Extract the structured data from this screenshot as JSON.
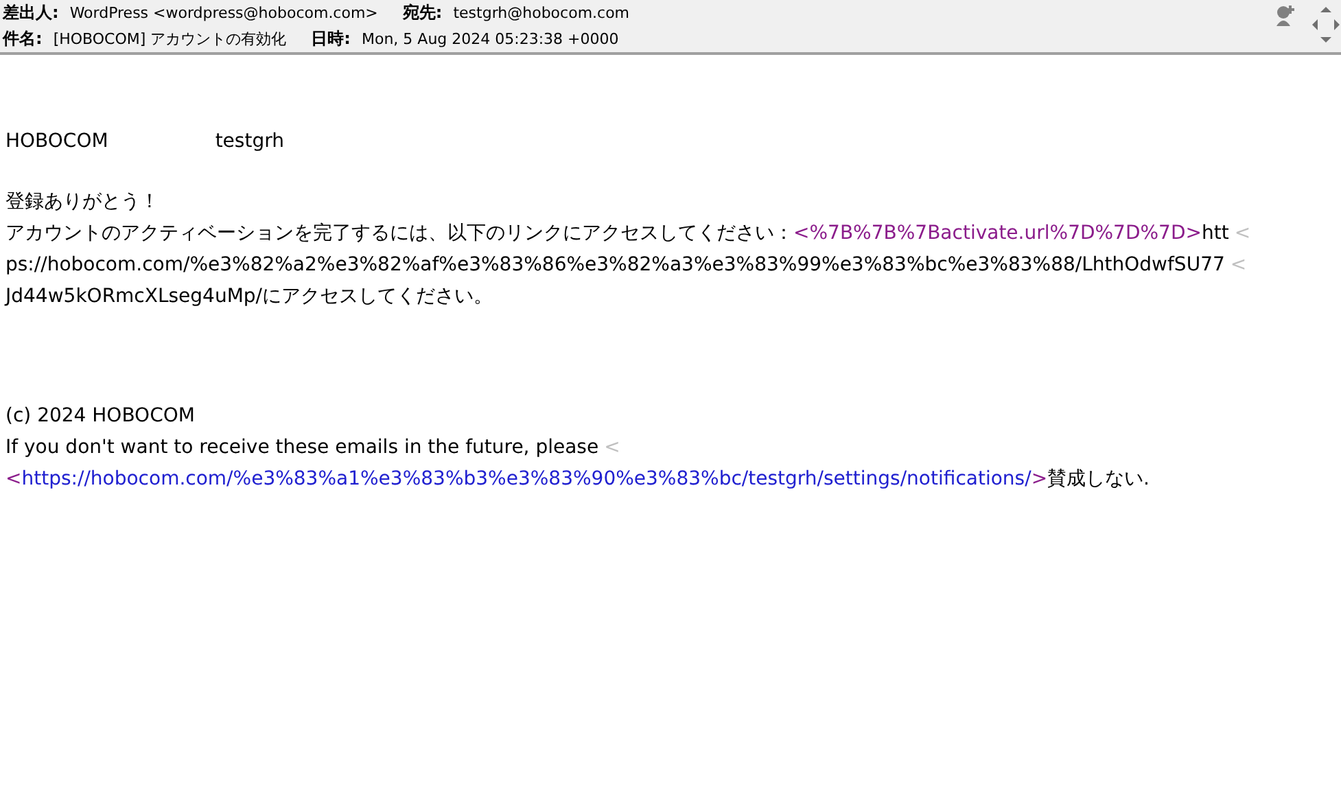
{
  "header": {
    "rows": [
      [
        {
          "label": "差出人:",
          "value": "WordPress <wordpress@hobocom.com>"
        },
        {
          "label": "宛先:",
          "value": "testgrh@hobocom.com"
        }
      ],
      [
        {
          "label": "件名:",
          "value": "[HOBOCOM] アカウントの有効化"
        },
        {
          "label": "日時:",
          "value": "Mon, 5 Aug 2024 05:23:38 +0000"
        }
      ]
    ]
  },
  "body": {
    "blocks": [
      {
        "lines": [
          [
            {
              "kind": "text",
              "text": "HOBOCOM"
            },
            {
              "kind": "gap"
            },
            {
              "kind": "text",
              "text": "testgrh"
            }
          ]
        ]
      },
      {
        "lines": [
          [
            {
              "kind": "text",
              "text": "登録ありがとう！"
            }
          ],
          [
            {
              "kind": "text",
              "text": "アカウントのアクティベーションを完了するには、以下のリンクにアクセスしてください："
            },
            {
              "kind": "visited_link",
              "text": "<%7B%7B%7Bactivate.url%7D%7D%7D>"
            },
            {
              "kind": "text",
              "text": "htt"
            },
            {
              "kind": "quote_mark",
              "text": "<"
            }
          ],
          [
            {
              "kind": "text",
              "text": "ps://hobocom.com/%e3%82%a2%e3%82%af%e3%83%86%e3%82%a3%e3%83%99%e3%83%bc%e3%83%88/LhthOdwfSU77"
            },
            {
              "kind": "quote_mark",
              "text": "<"
            }
          ],
          [
            {
              "kind": "text",
              "text": "Jd44w5kORmcXLseg4uMp/にアクセスしてください。"
            }
          ]
        ]
      },
      {
        "lines": [
          [
            {
              "kind": "text",
              "text": "(c) 2024 HOBOCOM"
            }
          ],
          [
            {
              "kind": "text",
              "text": "If you don't want to receive these emails in the future, please"
            },
            {
              "kind": "quote_mark",
              "text": "<"
            }
          ],
          [
            {
              "kind": "bracket",
              "text": "<"
            },
            {
              "kind": "link",
              "text": "https://hobocom.com/%e3%83%a1%e3%83%b3%e3%83%90%e3%83%bc/testgrh/settings/notifications/"
            },
            {
              "kind": "bracket",
              "text": ">"
            },
            {
              "kind": "text",
              "text": "賛成しない."
            }
          ]
        ]
      }
    ]
  }
}
